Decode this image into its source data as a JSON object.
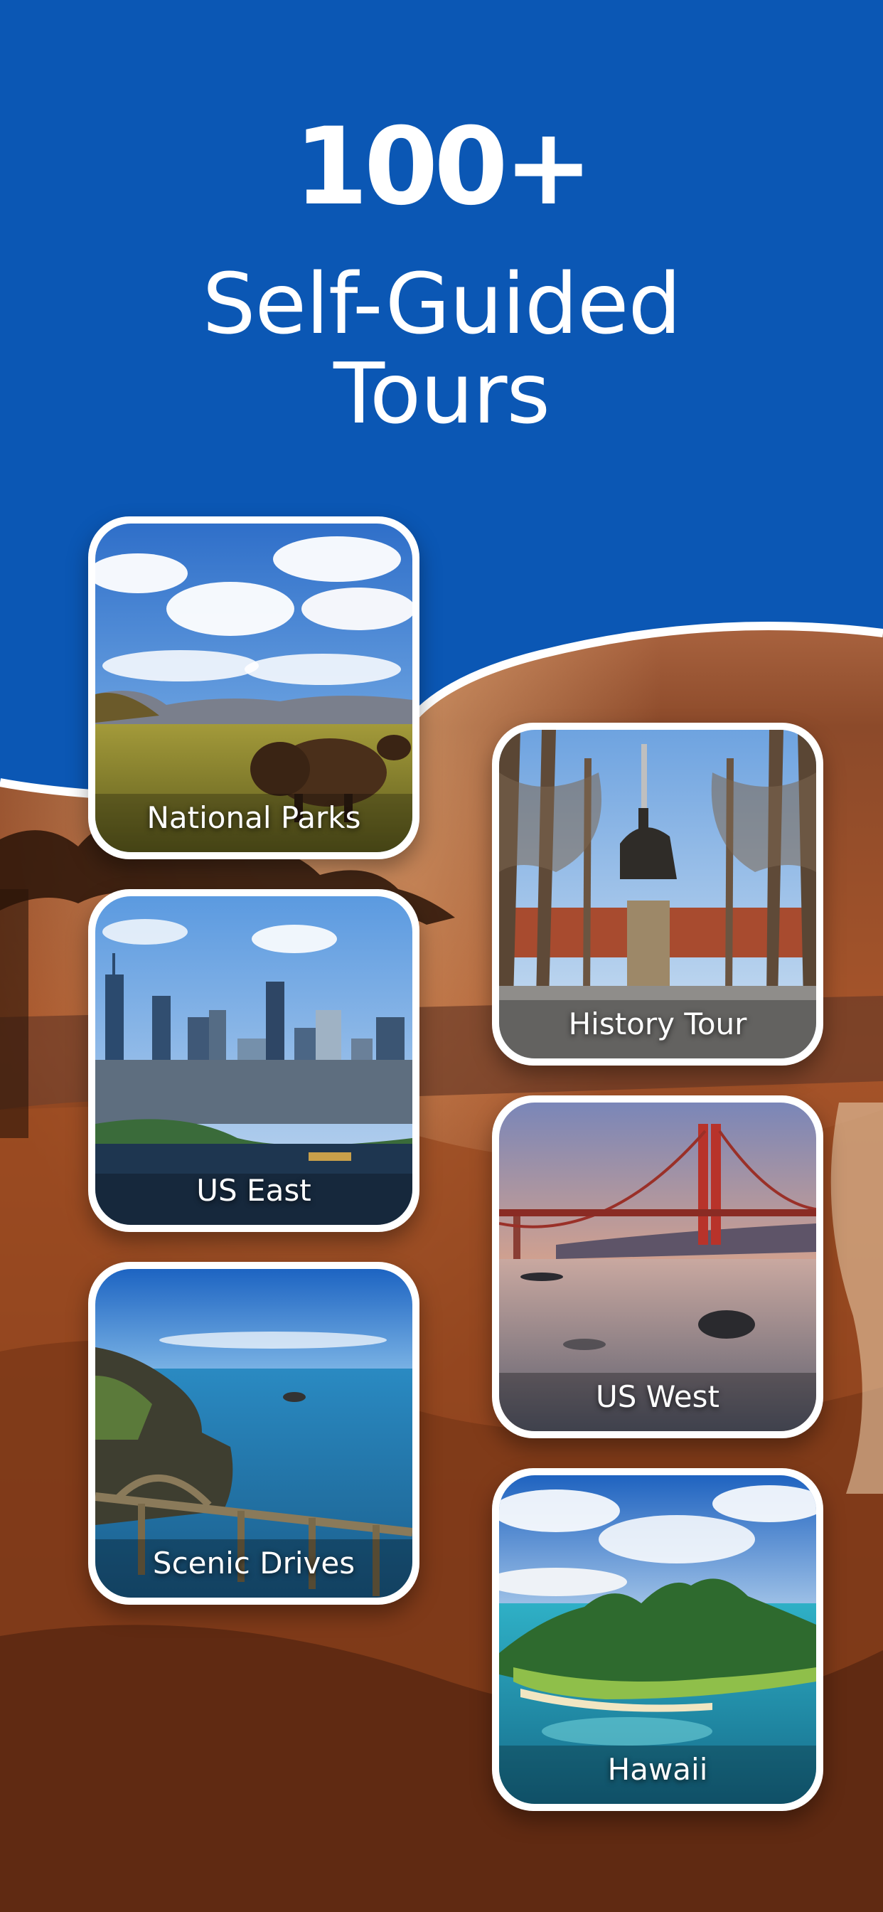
{
  "colors": {
    "brand_blue": "#0B57B4",
    "card_border": "#ffffff",
    "canyon_orange": "#C2622A"
  },
  "header": {
    "count": "100+",
    "line1": "Self-Guided",
    "line2": "Tours"
  },
  "tours": [
    {
      "label": "National Parks",
      "icon": "bison-prairie-photo"
    },
    {
      "label": "History Tour",
      "icon": "equestrian-statue-photo"
    },
    {
      "label": "US East",
      "icon": "city-skyline-photo"
    },
    {
      "label": "US West",
      "icon": "golden-gate-bridge-photo"
    },
    {
      "label": "Scenic Drives",
      "icon": "coastal-bridge-photo"
    },
    {
      "label": "Hawaii",
      "icon": "tropical-island-photo"
    }
  ]
}
